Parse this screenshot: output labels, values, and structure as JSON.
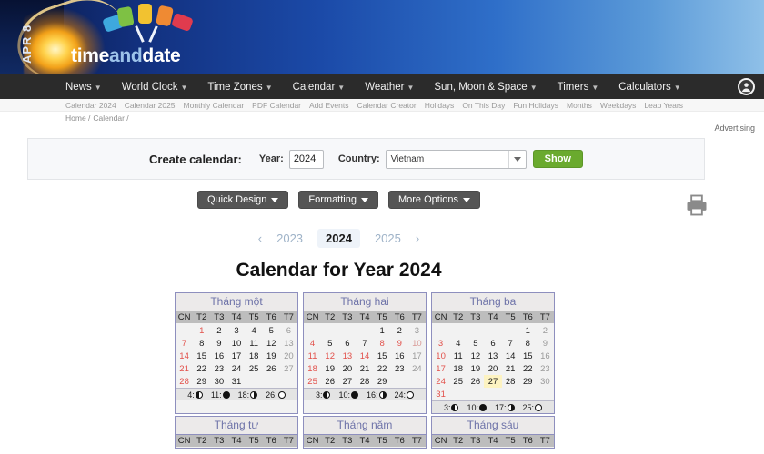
{
  "banner": {
    "date_badge": "APR 8",
    "logo_part1": "time",
    "logo_part2": "and",
    "logo_part3": "date"
  },
  "nav": {
    "items": [
      {
        "label": "News"
      },
      {
        "label": "World Clock"
      },
      {
        "label": "Time Zones"
      },
      {
        "label": "Calendar"
      },
      {
        "label": "Weather"
      },
      {
        "label": "Sun, Moon & Space"
      },
      {
        "label": "Timers"
      },
      {
        "label": "Calculators"
      }
    ],
    "account_icon": "user-icon"
  },
  "subnav": {
    "items": [
      "Calendar 2024",
      "Calendar 2025",
      "Monthly Calendar",
      "PDF Calendar",
      "Add Events",
      "Calendar Creator",
      "Holidays",
      "On This Day",
      "Fun Holidays",
      "Months",
      "Weekdays",
      "Leap Years"
    ]
  },
  "breadcrumb": {
    "items": [
      "Home /",
      "Calendar /"
    ]
  },
  "advertising": {
    "label": "Advertising"
  },
  "create_calendar": {
    "title": "Create calendar:",
    "year_label": "Year:",
    "year_value": "2024",
    "country_label": "Country:",
    "country_value": "Vietnam",
    "submit_label": "Show"
  },
  "options": [
    {
      "label": "Quick Design"
    },
    {
      "label": "Formatting"
    },
    {
      "label": "More Options"
    }
  ],
  "print": {
    "icon": "printer-icon"
  },
  "year_nav": {
    "prev_icon": "chevron-left-icon",
    "next_icon": "chevron-right-icon",
    "prev_year": "2023",
    "current_year": "2024",
    "next_year": "2025"
  },
  "page_title": "Calendar for Year 2024",
  "calendar": {
    "weekdays": [
      "CN",
      "T2",
      "T3",
      "T4",
      "T5",
      "T6",
      "T7"
    ],
    "colors": {
      "sunday": "#e2504a",
      "saturday": "#9a9a9a",
      "holiday": "#e2504a",
      "today": "#fdf3c2",
      "border": "#8e8fbe"
    },
    "months": [
      {
        "name": "Tháng một",
        "cells": [
          {
            "n": ""
          },
          {
            "n": "1",
            "t": "hol"
          },
          {
            "n": "2"
          },
          {
            "n": "3"
          },
          {
            "n": "4"
          },
          {
            "n": "5"
          },
          {
            "n": "6",
            "t": "sat"
          },
          {
            "n": "7",
            "t": "sun"
          },
          {
            "n": "8"
          },
          {
            "n": "9"
          },
          {
            "n": "10"
          },
          {
            "n": "11"
          },
          {
            "n": "12"
          },
          {
            "n": "13",
            "t": "sat"
          },
          {
            "n": "14",
            "t": "sun"
          },
          {
            "n": "15"
          },
          {
            "n": "16"
          },
          {
            "n": "17"
          },
          {
            "n": "18"
          },
          {
            "n": "19"
          },
          {
            "n": "20",
            "t": "sat"
          },
          {
            "n": "21",
            "t": "sun"
          },
          {
            "n": "22"
          },
          {
            "n": "23"
          },
          {
            "n": "24"
          },
          {
            "n": "25"
          },
          {
            "n": "26"
          },
          {
            "n": "27",
            "t": "sat"
          },
          {
            "n": "28",
            "t": "sun"
          },
          {
            "n": "29"
          },
          {
            "n": "30"
          },
          {
            "n": "31"
          },
          {
            "n": ""
          },
          {
            "n": ""
          },
          {
            "n": ""
          }
        ],
        "moon": [
          {
            "day": "4",
            "phase": "last"
          },
          {
            "day": "11",
            "phase": "new"
          },
          {
            "day": "18",
            "phase": "first"
          },
          {
            "day": "26",
            "phase": "full"
          }
        ]
      },
      {
        "name": "Tháng hai",
        "cells": [
          {
            "n": ""
          },
          {
            "n": ""
          },
          {
            "n": ""
          },
          {
            "n": ""
          },
          {
            "n": "1"
          },
          {
            "n": "2"
          },
          {
            "n": "3",
            "t": "sat"
          },
          {
            "n": "4",
            "t": "sun"
          },
          {
            "n": "5"
          },
          {
            "n": "6"
          },
          {
            "n": "7"
          },
          {
            "n": "8",
            "t": "hol"
          },
          {
            "n": "9",
            "t": "hol"
          },
          {
            "n": "10",
            "t": "holsat"
          },
          {
            "n": "11",
            "t": "sun"
          },
          {
            "n": "12",
            "t": "hol"
          },
          {
            "n": "13",
            "t": "hol"
          },
          {
            "n": "14",
            "t": "hol"
          },
          {
            "n": "15"
          },
          {
            "n": "16"
          },
          {
            "n": "17",
            "t": "sat"
          },
          {
            "n": "18",
            "t": "sun"
          },
          {
            "n": "19"
          },
          {
            "n": "20"
          },
          {
            "n": "21"
          },
          {
            "n": "22"
          },
          {
            "n": "23"
          },
          {
            "n": "24",
            "t": "sat"
          },
          {
            "n": "25",
            "t": "sun"
          },
          {
            "n": "26"
          },
          {
            "n": "27"
          },
          {
            "n": "28"
          },
          {
            "n": "29"
          },
          {
            "n": ""
          },
          {
            "n": ""
          }
        ],
        "moon": [
          {
            "day": "3",
            "phase": "last"
          },
          {
            "day": "10",
            "phase": "new"
          },
          {
            "day": "16",
            "phase": "first"
          },
          {
            "day": "24",
            "phase": "full"
          }
        ]
      },
      {
        "name": "Tháng ba",
        "cells": [
          {
            "n": ""
          },
          {
            "n": ""
          },
          {
            "n": ""
          },
          {
            "n": ""
          },
          {
            "n": ""
          },
          {
            "n": "1"
          },
          {
            "n": "2",
            "t": "sat"
          },
          {
            "n": "3",
            "t": "sun"
          },
          {
            "n": "4"
          },
          {
            "n": "5"
          },
          {
            "n": "6"
          },
          {
            "n": "7"
          },
          {
            "n": "8"
          },
          {
            "n": "9",
            "t": "sat"
          },
          {
            "n": "10",
            "t": "sun"
          },
          {
            "n": "11"
          },
          {
            "n": "12"
          },
          {
            "n": "13"
          },
          {
            "n": "14"
          },
          {
            "n": "15"
          },
          {
            "n": "16",
            "t": "sat"
          },
          {
            "n": "17",
            "t": "sun"
          },
          {
            "n": "18"
          },
          {
            "n": "19"
          },
          {
            "n": "20"
          },
          {
            "n": "21"
          },
          {
            "n": "22"
          },
          {
            "n": "23",
            "t": "sat"
          },
          {
            "n": "24",
            "t": "sun"
          },
          {
            "n": "25"
          },
          {
            "n": "26"
          },
          {
            "n": "27",
            "t": "today"
          },
          {
            "n": "28"
          },
          {
            "n": "29"
          },
          {
            "n": "30",
            "t": "sat"
          },
          {
            "n": "31",
            "t": "sun"
          },
          {
            "n": ""
          },
          {
            "n": ""
          },
          {
            "n": ""
          },
          {
            "n": ""
          },
          {
            "n": ""
          },
          {
            "n": ""
          }
        ],
        "moon": [
          {
            "day": "3",
            "phase": "last"
          },
          {
            "day": "10",
            "phase": "new"
          },
          {
            "day": "17",
            "phase": "first"
          },
          {
            "day": "25",
            "phase": "full"
          }
        ]
      },
      {
        "name": "Tháng tư",
        "cells": [],
        "moon": []
      },
      {
        "name": "Tháng năm",
        "cells": [],
        "moon": []
      },
      {
        "name": "Tháng sáu",
        "cells": [],
        "moon": []
      }
    ]
  }
}
